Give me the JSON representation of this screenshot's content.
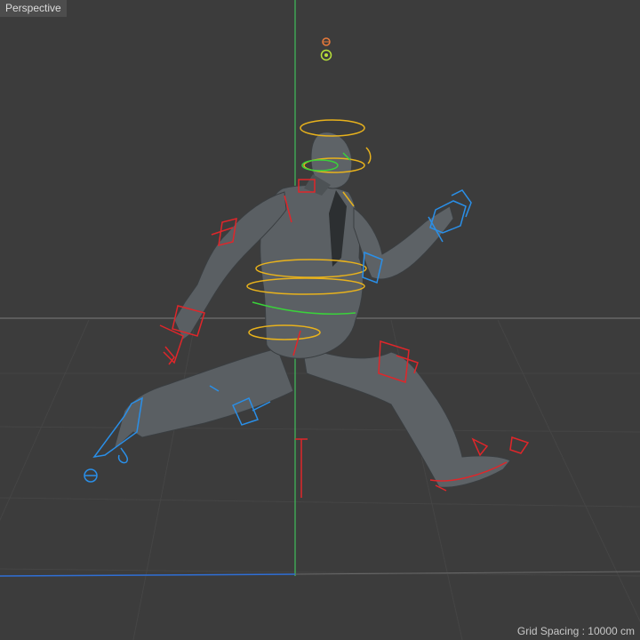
{
  "viewport": {
    "label": "Perspective",
    "grid_spacing": "Grid Spacing : 10000 cm"
  },
  "colors": {
    "background": "#3c3c3c",
    "grid": "#454545",
    "horizon": "#5a5a5a",
    "y_axis": "#3fbf5a",
    "x_axis": "#2f6fd6",
    "mesh": "#5a5f63",
    "mesh_shade": "#3a3e41",
    "control_red": "#e0262a",
    "control_blue": "#2a8fe8",
    "control_yellow": "#e8b21c",
    "control_green": "#3ad23a"
  },
  "icons": {
    "camera": "camera-icon",
    "light": "light-icon"
  }
}
